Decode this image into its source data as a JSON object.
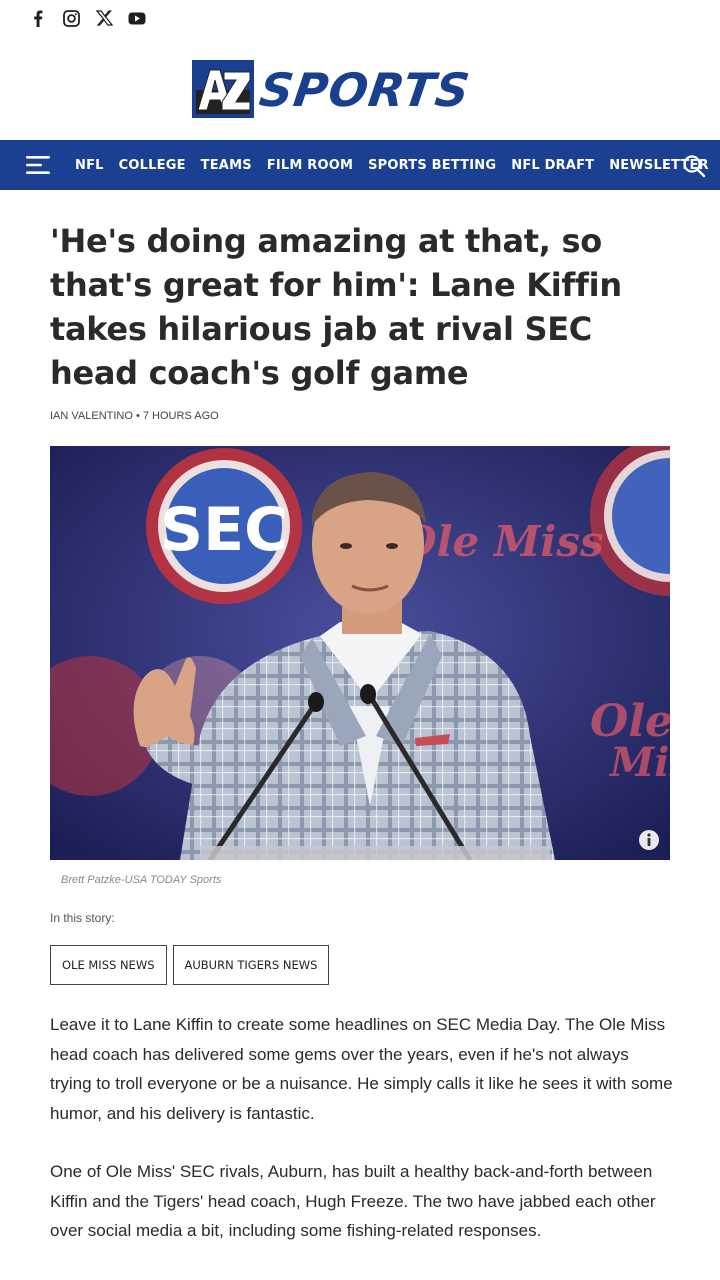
{
  "social": {
    "icons": [
      "facebook-icon",
      "instagram-icon",
      "x-icon",
      "youtube-icon"
    ]
  },
  "logo": {
    "az": "AZ",
    "sports": "SPORTS"
  },
  "nav": {
    "links": [
      "NFL",
      "COLLEGE",
      "TEAMS",
      "FILM ROOM",
      "SPORTS BETTING",
      "NFL DRAFT",
      "NEWSLETTER"
    ],
    "menu_icon": "hamburger-menu-icon",
    "search_icon": "search-icon"
  },
  "article": {
    "headline": "'He's doing amazing at that, so that's great for him': Lane Kiffin takes hilarious jab at rival SEC head coach's golf game",
    "byline": "IAN VALENTINO • 7 HOURS AGO",
    "image_caption": "Brett Patzke-USA TODAY Sports",
    "in_this_story_label": "In this story:",
    "tags": [
      "OLE MISS NEWS",
      "AUBURN TIGERS NEWS"
    ],
    "paragraphs": [
      "Leave it to Lane Kiffin to create some headlines on SEC Media Day. The Ole Miss head coach has delivered some gems over the years, even if he's not always trying to troll everyone or be a nuisance. He simply calls it like he sees it with some humor, and his delivery is fantastic.",
      "One of Ole Miss' SEC rivals, Auburn, has built a healthy back-and-forth between Kiffin and the Tigers' head coach, Hugh Freeze. The two have jabbed each other over social media a bit, including some fishing-related responses."
    ],
    "hero_image_text": {
      "sec_logo": "SEC",
      "ole_miss_script": "Ole Miss"
    }
  },
  "colors": {
    "nav_background": "#1b3f91",
    "brand_blue": "#1a3f8e"
  }
}
